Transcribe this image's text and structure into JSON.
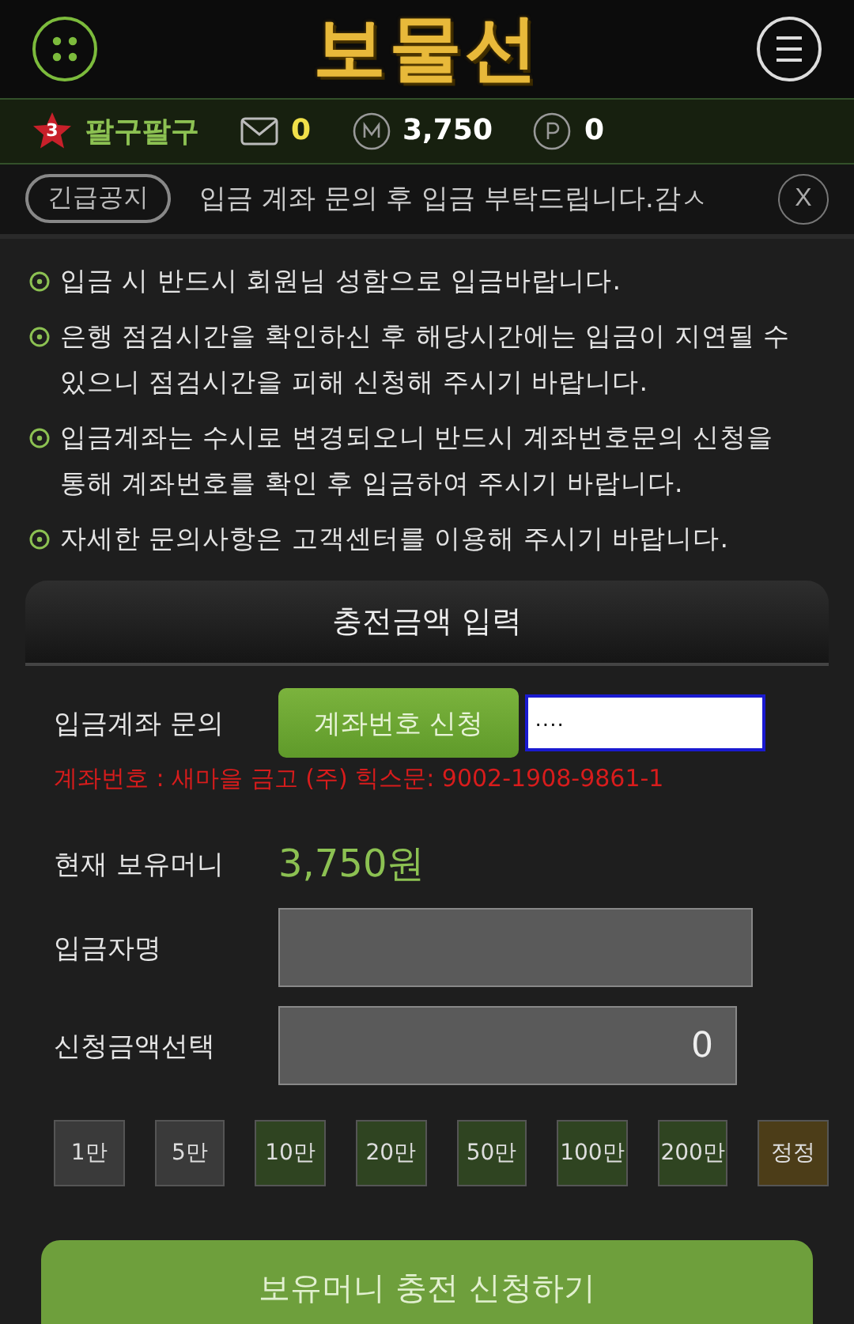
{
  "header": {
    "logo": "보물선"
  },
  "user_bar": {
    "level": "3",
    "nickname": "팔구팔구",
    "messages": "0",
    "money": "3,750",
    "points": "0"
  },
  "notice_bar": {
    "badge": "긴급공지",
    "text": "입금 계좌 문의 후 입금 부탁드립니다.감ㅅ",
    "close": "X"
  },
  "notices": [
    "입금 시 반드시 회원님 성함으로 입금바랍니다.",
    "은행 점검시간을 확인하신 후 해당시간에는 입금이 지연될 수 있으니 점검시간을 피해 신청해 주시기 바랍니다.",
    "입금계좌는 수시로 변경되오니 반드시 계좌번호문의 신청을 통해 계좌번호를 확인 후 입금하여 주시기 바랍니다.",
    "자세한 문의사항은 고객센터를 이용해 주시기 바랍니다."
  ],
  "panel": {
    "title": "충전금액 입력",
    "account_label": "입금계좌 문의",
    "account_button": "계좌번호 신청",
    "account_input": "····",
    "account_info": "계좌번호 : 새마을 금고 (주) 힉스문: 9002-1908-9861-1",
    "balance_label": "현재 보유머니",
    "balance": "3,750원",
    "depositor_label": "입금자명",
    "amount_label": "신청금액선택",
    "amount": "0",
    "amount_buttons": [
      {
        "label": "1만",
        "kind": "basic"
      },
      {
        "label": "5만",
        "kind": "basic"
      },
      {
        "label": "10만",
        "kind": "large"
      },
      {
        "label": "20만",
        "kind": "large"
      },
      {
        "label": "50만",
        "kind": "large"
      },
      {
        "label": "100만",
        "kind": "large"
      },
      {
        "label": "200만",
        "kind": "large"
      },
      {
        "label": "정정",
        "kind": "reset"
      }
    ],
    "submit": "보유머니 충전 신청하기"
  }
}
